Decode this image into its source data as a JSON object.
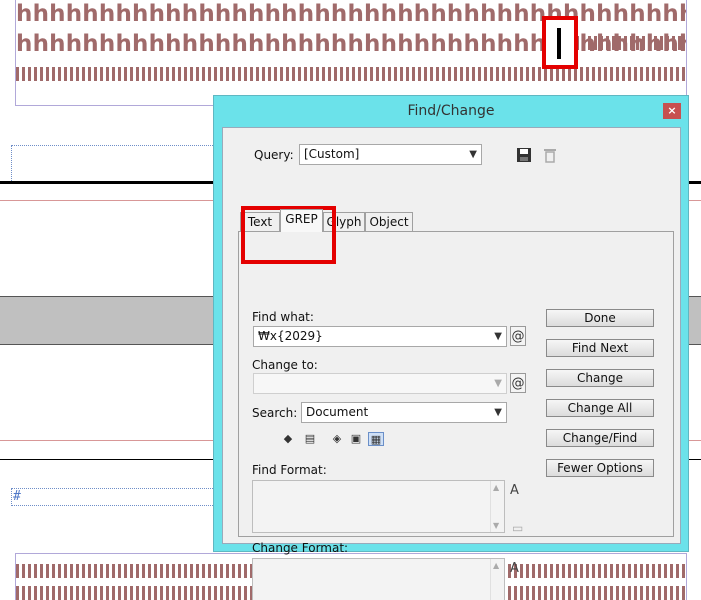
{
  "document": {
    "h_line_1": "hhhhhhhhhhhhhhhhhhhhhhhhhhhhhhhhhhhhhhhhhhhhhhhhhhhhhhhh",
    "h_line_2": "hhhhhhhhhhhhhhhhhhhhhhhhhhhhhhhhhhhhhhhhhhhh",
    "hash_mark": "#"
  },
  "dialog": {
    "title": "Find/Change",
    "close_label": "×",
    "query": {
      "label": "Query:",
      "value": "[Custom]"
    },
    "tabs": [
      {
        "label": "Text"
      },
      {
        "label": "GREP"
      },
      {
        "label": "Glyph"
      },
      {
        "label": "Object"
      }
    ],
    "find_what": {
      "label": "Find what:",
      "value": "₩x{2029}"
    },
    "change_to": {
      "label": "Change to:",
      "value": ""
    },
    "search": {
      "label": "Search:",
      "value": "Document"
    },
    "find_format": {
      "label": "Find Format:"
    },
    "change_format": {
      "label": "Change Format:"
    },
    "buttons": {
      "done": "Done",
      "find_next": "Find Next",
      "change": "Change",
      "change_all": "Change All",
      "change_find": "Change/Find",
      "fewer_options": "Fewer Options"
    },
    "icons": {
      "at_symbol": "@",
      "save": "💾",
      "trash": "🗑"
    }
  },
  "colors": {
    "dialog_frame": "#6be2ea",
    "highlight": "#e40000",
    "document_text": "#a06a6a"
  }
}
